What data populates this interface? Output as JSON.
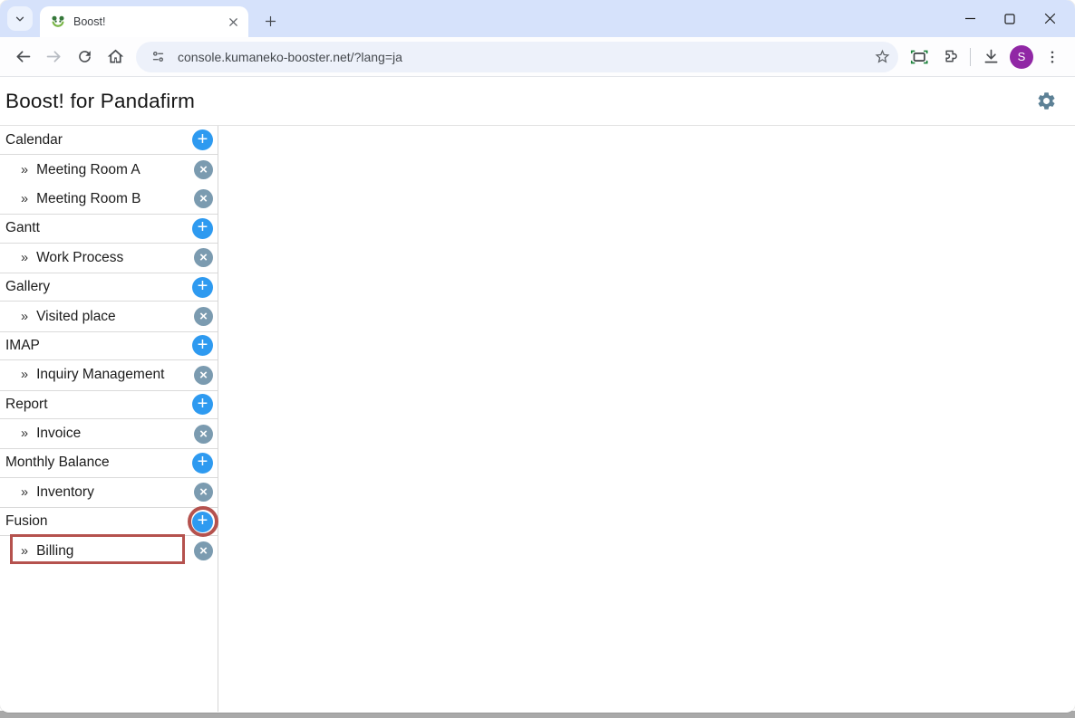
{
  "browser": {
    "tab": {
      "title": "Boost!"
    },
    "omnibox": {
      "url": "console.kumaneko-booster.net/?lang=ja"
    },
    "profile": {
      "initial": "S"
    }
  },
  "page": {
    "title": "Boost! for Pandafirm"
  },
  "sidebar": {
    "item_prefix": "»",
    "add_glyph": "+",
    "remove_glyph": "×",
    "groups": [
      {
        "label": "Calendar",
        "items": [
          "Meeting Room A",
          "Meeting Room B"
        ]
      },
      {
        "label": "Gantt",
        "items": [
          "Work Process"
        ]
      },
      {
        "label": "Gallery",
        "items": [
          "Visited place"
        ]
      },
      {
        "label": "IMAP",
        "items": [
          "Inquiry Management"
        ]
      },
      {
        "label": "Report",
        "items": [
          "Invoice"
        ]
      },
      {
        "label": "Monthly Balance",
        "items": [
          "Inventory"
        ]
      },
      {
        "label": "Fusion",
        "items": [
          "Billing"
        ]
      }
    ]
  },
  "annotations": {
    "color": "#b5524e",
    "circled_element": "fusion-add-button",
    "boxed_element": "billing-item"
  },
  "icons": [
    "panda-favicon-icon",
    "tab-search-chevron-icon",
    "tab-close-icon",
    "new-tab-plus-icon",
    "minimize-icon",
    "maximize-icon",
    "window-close-icon",
    "back-arrow-icon",
    "forward-arrow-icon",
    "reload-icon",
    "home-icon",
    "site-info-tune-icon",
    "bookmark-star-icon",
    "screen-capture-icon",
    "extensions-puzzle-icon",
    "download-icon",
    "profile-avatar",
    "menu-kebab-icon",
    "gear-icon",
    "add-plus-icon",
    "remove-x-icon"
  ],
  "colors": {
    "tabstrip_bg": "#d6e2fb",
    "omnibox_bg": "#edf1fa",
    "add_button_blue": "#2e9af0",
    "remove_button_gray_blue": "#7b9bb0",
    "annotation_red": "#b5524e",
    "gear_slate": "#5d8196",
    "avatar_purple": "#9027a5"
  }
}
